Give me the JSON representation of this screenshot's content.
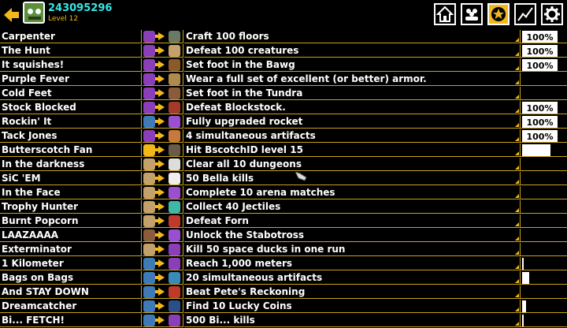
{
  "header": {
    "user_id": "243095296",
    "level": "Level 12",
    "icons": [
      "back-arrow-icon",
      "frog-avatar",
      "home-icon",
      "group-icon",
      "star-icon",
      "stats-icon",
      "gear-icon"
    ],
    "accent": "#f2b81a"
  },
  "rows": [
    {
      "name": "Carpenter",
      "desc": "Craft 100 floors",
      "progress": "100%",
      "fill": 1.0,
      "c1": "#8a3fb8",
      "c2": "#6a7a64"
    },
    {
      "name": "The Hunt",
      "desc": "Defeat 100 creatures",
      "progress": "100%",
      "fill": 1.0,
      "c1": "#8a3fb8",
      "c2": "#c4a06a"
    },
    {
      "name": "It squishes!",
      "desc": "Set foot in the Bawg",
      "progress": "100%",
      "fill": 1.0,
      "c1": "#8a3fb8",
      "c2": "#8b5a2b"
    },
    {
      "name": "Purple Fever",
      "desc": "Wear a full set of excellent (or better) armor.",
      "progress": "",
      "fill": 0,
      "c1": "#8a3fb8",
      "c2": "#b08a4a"
    },
    {
      "name": "Cold Feet",
      "desc": "Set foot in the Tundra",
      "progress": "",
      "fill": 0,
      "c1": "#8a3fb8",
      "c2": "#8a5c3a"
    },
    {
      "name": "Stock Blocked",
      "desc": "Defeat Blockstock.",
      "progress": "100%",
      "fill": 1.0,
      "c1": "#8a3fb8",
      "c2": "#a33a2a"
    },
    {
      "name": "Rockin' It",
      "desc": "Fully upgraded rocket",
      "progress": "100%",
      "fill": 1.0,
      "c1": "#3f7ab8",
      "c2": "#9a4fd0"
    },
    {
      "name": "Tack Jones",
      "desc": "4 simultaneous artifacts",
      "progress": "100%",
      "fill": 1.0,
      "c1": "#8a3fb8",
      "c2": "#c87a3a"
    },
    {
      "name": "Butterscotch Fan",
      "desc": "Hit BscotchID level 15",
      "progress": "",
      "fill": 0.8,
      "c1": "#f2b81a",
      "c2": "#6a5a4a"
    },
    {
      "name": "In the darkness",
      "desc": "Clear all 10 dungeons",
      "progress": "",
      "fill": 0,
      "c1": "#c4a06a",
      "c2": "#dddddd"
    },
    {
      "name": "SiC 'EM",
      "desc": "50 Bella kills",
      "progress": "",
      "fill": 0,
      "c1": "#c4a06a",
      "c2": "#eeeeee"
    },
    {
      "name": "In the Face",
      "desc": "Complete 10 arena matches",
      "progress": "",
      "fill": 0,
      "c1": "#c4a06a",
      "c2": "#9a4fd0"
    },
    {
      "name": "Trophy Hunter",
      "desc": "Collect 40 Jectiles",
      "progress": "",
      "fill": 0,
      "c1": "#c4a06a",
      "c2": "#3fb8a8"
    },
    {
      "name": "Burnt Popcorn",
      "desc": "Defeat Forn",
      "progress": "",
      "fill": 0,
      "c1": "#c4a06a",
      "c2": "#c0392b"
    },
    {
      "name": "LAAZAAAA",
      "desc": "Unlock the Stabotross",
      "progress": "",
      "fill": 0,
      "c1": "#8a5c3a",
      "c2": "#9a4fd0"
    },
    {
      "name": "Exterminator",
      "desc": "Kill 50 space ducks in one run",
      "progress": "",
      "fill": 0,
      "c1": "#c4a06a",
      "c2": "#8a3fb8"
    },
    {
      "name": "1 Kilometer",
      "desc": "Reach 1,000 meters",
      "progress": "",
      "fill": 0.03,
      "c1": "#3f7ab8",
      "c2": "#8a3fb8"
    },
    {
      "name": "Bags on Bags",
      "desc": "20 simultaneous artifacts",
      "progress": "",
      "fill": 0.2,
      "c1": "#3f7ab8",
      "c2": "#3a8ab8"
    },
    {
      "name": "And STAY DOWN",
      "desc": "Beat Pete's Reckoning",
      "progress": "",
      "fill": 0,
      "c1": "#3f7ab8",
      "c2": "#c0392b"
    },
    {
      "name": "Dreamcatcher",
      "desc": "Find 10 Lucky Coins",
      "progress": "",
      "fill": 0.1,
      "c1": "#3f7ab8",
      "c2": "#2a4f8a"
    },
    {
      "name": "Bi... FETCH!",
      "desc": "500 Bi... kills",
      "progress": "",
      "fill": 0.03,
      "c1": "#3f7ab8",
      "c2": "#8a3fb8"
    }
  ]
}
